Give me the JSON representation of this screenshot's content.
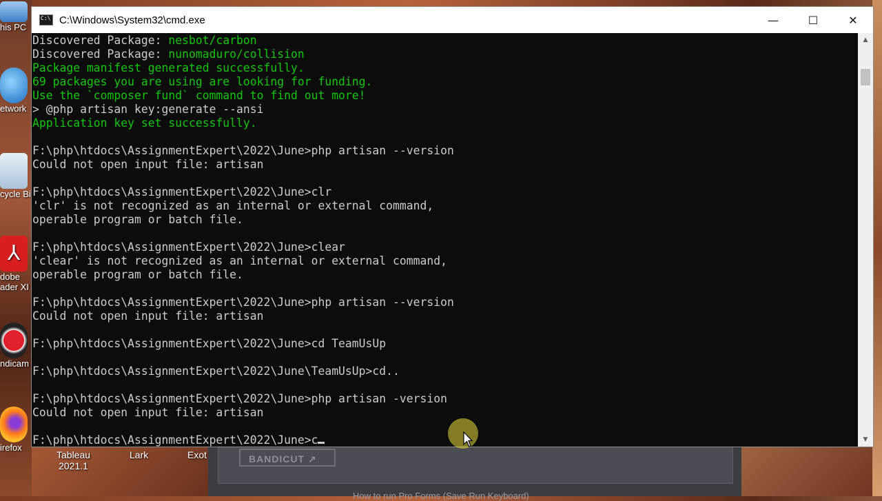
{
  "window": {
    "title": "C:\\Windows\\System32\\cmd.exe",
    "minimize_icon": "minimize-icon",
    "maximize_icon": "maximize-icon",
    "close_icon": "close-icon"
  },
  "console": {
    "lines": [
      {
        "segments": [
          {
            "text": "Discovered Package: ",
            "color": "default"
          },
          {
            "text": "nesbot/carbon",
            "color": "green"
          }
        ]
      },
      {
        "segments": [
          {
            "text": "Discovered Package: ",
            "color": "default"
          },
          {
            "text": "nunomaduro/collision",
            "color": "green"
          }
        ]
      },
      {
        "segments": [
          {
            "text": "Package manifest generated successfully.",
            "color": "green"
          }
        ]
      },
      {
        "segments": [
          {
            "text": "69 packages you are using are looking for funding.",
            "color": "green"
          }
        ]
      },
      {
        "segments": [
          {
            "text": "Use the `composer fund` command to find out more!",
            "color": "green"
          }
        ]
      },
      {
        "segments": [
          {
            "text": "> @php artisan key:generate --ansi",
            "color": "default"
          }
        ]
      },
      {
        "segments": [
          {
            "text": "Application key set successfully.",
            "color": "green"
          }
        ]
      },
      {
        "segments": [
          {
            "text": "",
            "color": "default"
          }
        ]
      },
      {
        "segments": [
          {
            "text": "F:\\php\\htdocs\\AssignmentExpert\\2022\\June>php artisan --version",
            "color": "default"
          }
        ]
      },
      {
        "segments": [
          {
            "text": "Could not open input file: artisan",
            "color": "default"
          }
        ]
      },
      {
        "segments": [
          {
            "text": "",
            "color": "default"
          }
        ]
      },
      {
        "segments": [
          {
            "text": "F:\\php\\htdocs\\AssignmentExpert\\2022\\June>clr",
            "color": "default"
          }
        ]
      },
      {
        "segments": [
          {
            "text": "'clr' is not recognized as an internal or external command,",
            "color": "default"
          }
        ]
      },
      {
        "segments": [
          {
            "text": "operable program or batch file.",
            "color": "default"
          }
        ]
      },
      {
        "segments": [
          {
            "text": "",
            "color": "default"
          }
        ]
      },
      {
        "segments": [
          {
            "text": "F:\\php\\htdocs\\AssignmentExpert\\2022\\June>clear",
            "color": "default"
          }
        ]
      },
      {
        "segments": [
          {
            "text": "'clear' is not recognized as an internal or external command,",
            "color": "default"
          }
        ]
      },
      {
        "segments": [
          {
            "text": "operable program or batch file.",
            "color": "default"
          }
        ]
      },
      {
        "segments": [
          {
            "text": "",
            "color": "default"
          }
        ]
      },
      {
        "segments": [
          {
            "text": "F:\\php\\htdocs\\AssignmentExpert\\2022\\June>php artisan --version",
            "color": "default"
          }
        ]
      },
      {
        "segments": [
          {
            "text": "Could not open input file: artisan",
            "color": "default"
          }
        ]
      },
      {
        "segments": [
          {
            "text": "",
            "color": "default"
          }
        ]
      },
      {
        "segments": [
          {
            "text": "F:\\php\\htdocs\\AssignmentExpert\\2022\\June>cd TeamUsUp",
            "color": "default"
          }
        ]
      },
      {
        "segments": [
          {
            "text": "",
            "color": "default"
          }
        ]
      },
      {
        "segments": [
          {
            "text": "F:\\php\\htdocs\\AssignmentExpert\\2022\\June\\TeamUsUp>cd..",
            "color": "default"
          }
        ]
      },
      {
        "segments": [
          {
            "text": "",
            "color": "default"
          }
        ]
      },
      {
        "segments": [
          {
            "text": "F:\\php\\htdocs\\AssignmentExpert\\2022\\June>php artisan -version",
            "color": "default"
          }
        ]
      },
      {
        "segments": [
          {
            "text": "Could not open input file: artisan",
            "color": "default"
          }
        ]
      },
      {
        "segments": [
          {
            "text": "",
            "color": "default"
          }
        ]
      },
      {
        "segments": [
          {
            "text": "F:\\php\\htdocs\\AssignmentExpert\\2022\\June>c",
            "color": "default"
          }
        ],
        "cursor": true
      }
    ]
  },
  "desktop": {
    "left_icons": [
      {
        "label": "his PC",
        "icon": "this-pc-icon"
      },
      {
        "label": "etwork",
        "icon": "network-icon"
      },
      {
        "label": "cycle Bi",
        "icon": "recycle-bin-icon"
      },
      {
        "label": "dobe",
        "label2": "ader XI",
        "icon": "adobe-reader-icon"
      },
      {
        "label": "ndicam",
        "icon": "bandicam-icon"
      },
      {
        "label": "irefox",
        "icon": "firefox-icon"
      }
    ],
    "bottom_icons": [
      {
        "label": "Tableau",
        "label2": "2021.1"
      },
      {
        "label": "Lark"
      },
      {
        "label": "Exot"
      }
    ]
  },
  "bandicut": {
    "logo": "BANDICUT ↗",
    "status": "How to run Pro Forms (Save Run Keyboard)"
  },
  "colors": {
    "console_bg": "#0c0c0c",
    "console_fg": "#cccccc",
    "green": "#16c60c"
  }
}
